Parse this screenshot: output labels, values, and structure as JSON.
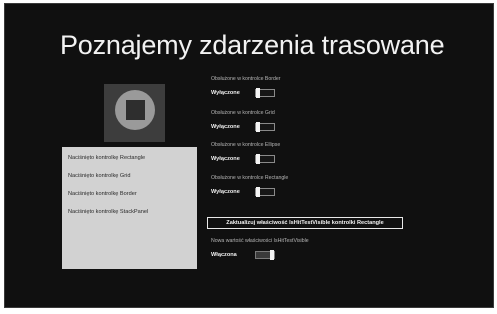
{
  "page": {
    "title": "Poznajemy zdarzenia trasowane"
  },
  "log": {
    "items": [
      "Naciśnięto kontrolkę Rectangle",
      "Naciśnięto kontrolkę Grid",
      "Naciśnięto kontrolkę Border",
      "Naciśnięto kontrolkę StackPanel"
    ]
  },
  "settings": [
    {
      "label": "Obsłużone w kontrolce Border",
      "state": "Wyłączone",
      "on": false
    },
    {
      "label": "Obsłużone w kontrolce Grid",
      "state": "Wyłączone",
      "on": false
    },
    {
      "label": "Obsłużone w kontrolce Ellipse",
      "state": "Wyłączone",
      "on": false
    },
    {
      "label": "Obsłużone w kontrolce Rectangle",
      "state": "Wyłączone",
      "on": false
    }
  ],
  "update": {
    "button_label": "Zaktualizuj właściwość IsHitTestVisible kontrolki Rectangle",
    "new_value_label": "Nowa wartość właściwości IsHitTestVisible",
    "new_value_state": "Włączona",
    "on": true
  },
  "colors": {
    "background": "#101010",
    "text": "#f2f2f2",
    "panel": "#d2d2d2"
  }
}
